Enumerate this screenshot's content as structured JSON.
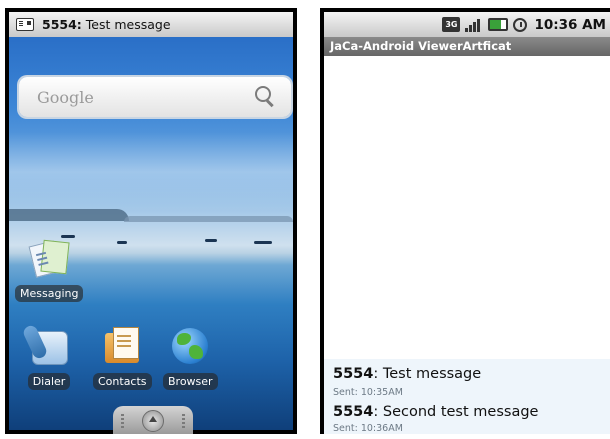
{
  "left_screen": {
    "notification": {
      "sender": "5554",
      "separator": ":",
      "text": " Test message"
    },
    "search": {
      "placeholder": "Google"
    },
    "apps": [
      {
        "label": "Messaging",
        "icon": "messaging-icon"
      },
      {
        "label": "Dialer",
        "icon": "dialer-icon"
      },
      {
        "label": "Contacts",
        "icon": "contacts-icon"
      },
      {
        "label": "Browser",
        "icon": "browser-icon"
      }
    ]
  },
  "right_screen": {
    "status": {
      "network": "3G",
      "time": "10:36 AM"
    },
    "title": "JaCa-Android ViewerArtficat",
    "messages": [
      {
        "sender": "5554",
        "separator": ":",
        "text": " Test message",
        "sent": "Sent: 10:35AM"
      },
      {
        "sender": "5554",
        "separator": ":",
        "text": " Second test message",
        "sent": "Sent: 10:36AM"
      }
    ]
  },
  "colors": {
    "status_bar": "#d9d9d9",
    "title_bar": "#777777",
    "message_bg": "#eef5fb",
    "wallpaper_sky": "#3d86d6"
  }
}
